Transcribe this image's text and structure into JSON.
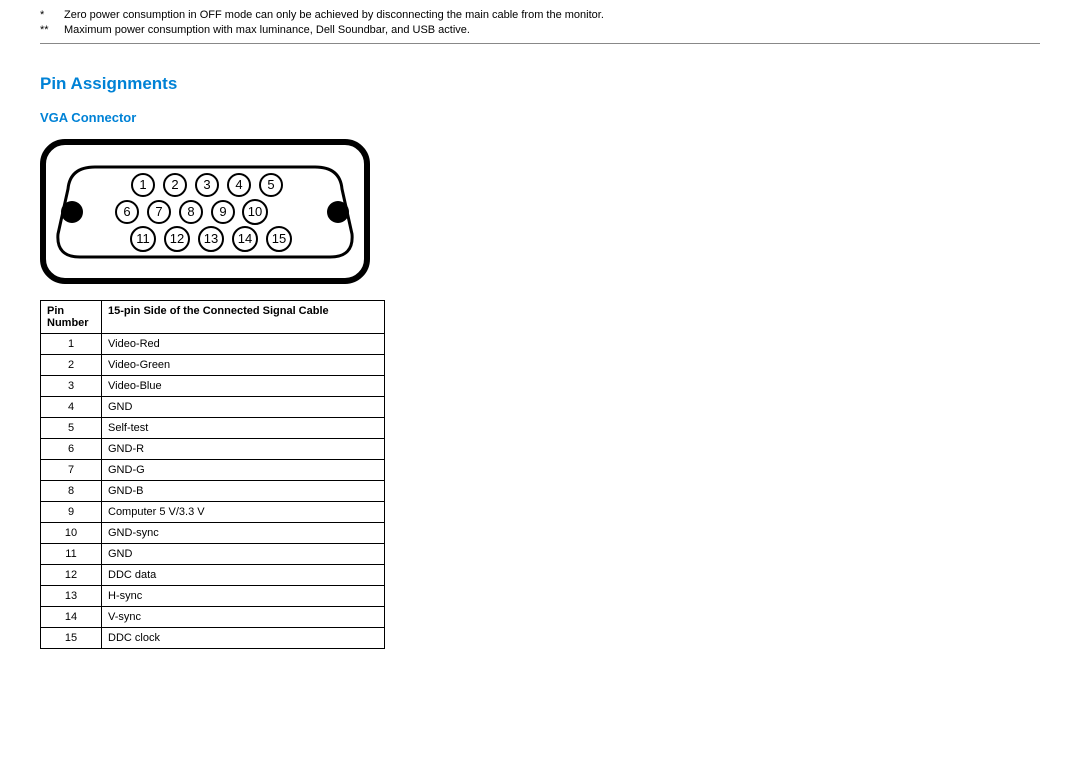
{
  "footnotes": [
    {
      "mark": "*",
      "text": "Zero power consumption in OFF mode can only be achieved by disconnecting the main cable from the monitor."
    },
    {
      "mark": "**",
      "text": "Maximum power consumption with max luminance, Dell Soundbar, and USB active."
    }
  ],
  "section_title": "Pin Assignments",
  "sub_title": "VGA Connector",
  "diagram": {
    "pins_row1": [
      "1",
      "2",
      "3",
      "4",
      "5"
    ],
    "pins_row2": [
      "6",
      "7",
      "8",
      "9",
      "10"
    ],
    "pins_row3": [
      "11",
      "12",
      "13",
      "14",
      "15"
    ]
  },
  "table": {
    "header_pin": "Pin Number",
    "header_desc": "15-pin Side of the Connected Signal Cable",
    "rows": [
      {
        "pin": "1",
        "desc": "Video-Red"
      },
      {
        "pin": "2",
        "desc": "Video-Green"
      },
      {
        "pin": "3",
        "desc": "Video-Blue"
      },
      {
        "pin": "4",
        "desc": "GND"
      },
      {
        "pin": "5",
        "desc": "Self-test"
      },
      {
        "pin": "6",
        "desc": "GND-R"
      },
      {
        "pin": "7",
        "desc": "GND-G"
      },
      {
        "pin": "8",
        "desc": "GND-B"
      },
      {
        "pin": "9",
        "desc": "Computer 5 V/3.3 V"
      },
      {
        "pin": "10",
        "desc": "GND-sync"
      },
      {
        "pin": "11",
        "desc": "GND"
      },
      {
        "pin": "12",
        "desc": "DDC data"
      },
      {
        "pin": "13",
        "desc": "H-sync"
      },
      {
        "pin": "14",
        "desc": "V-sync"
      },
      {
        "pin": "15",
        "desc": "DDC clock"
      }
    ]
  }
}
